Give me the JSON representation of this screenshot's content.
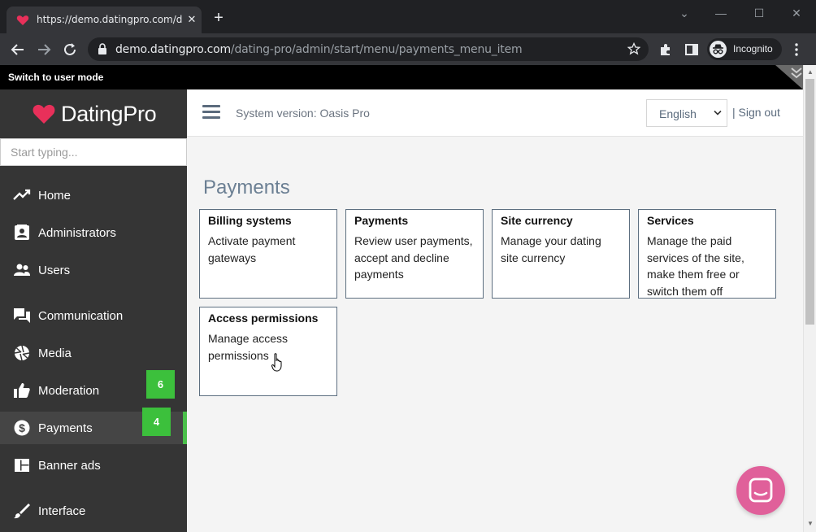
{
  "browser": {
    "tab_title": "https://demo.datingpro.com/dating-pro/admin/start/menu/payments_menu_item",
    "url_host": "demo.datingpro.com",
    "url_path": "/dating-pro/admin/start/menu/payments_menu_item",
    "incognito_label": "Incognito"
  },
  "userbar": {
    "switch_label": "Switch to user mode"
  },
  "sidebar": {
    "logo_text": "DatingPro",
    "search_placeholder": "Start typing...",
    "items": [
      {
        "label": "Home",
        "icon": "trending-up-icon"
      },
      {
        "label": "Administrators",
        "icon": "contact-card-icon"
      },
      {
        "label": "Users",
        "icon": "people-icon"
      },
      {
        "label": "Communication",
        "icon": "chat-icon"
      },
      {
        "label": "Media",
        "icon": "aperture-icon"
      },
      {
        "label": "Moderation",
        "icon": "thumbs-up-icon",
        "badge": "6"
      },
      {
        "label": "Payments",
        "icon": "dollar-icon",
        "badge": "4",
        "active": true
      },
      {
        "label": "Banner ads",
        "icon": "banner-icon"
      },
      {
        "label": "Interface",
        "icon": "brush-icon"
      }
    ]
  },
  "header": {
    "system_version": "System version: Oasis Pro",
    "language": "English",
    "sign_out": "| Sign out"
  },
  "page": {
    "title": "Payments",
    "cards": [
      {
        "title": "Billing systems",
        "desc": "Activate payment gateways"
      },
      {
        "title": "Payments",
        "desc": "Review user payments, accept and decline payments"
      },
      {
        "title": "Site currency",
        "desc": "Manage your dating site currency"
      },
      {
        "title": "Services",
        "desc": "Manage the paid services of the site, make them free or switch them off"
      },
      {
        "title": "Access permissions",
        "desc": "Manage access permissions"
      }
    ]
  },
  "colors": {
    "sidebar_bg": "#353535",
    "badge_green": "#3cc03c",
    "accent_pink": "#e0609a",
    "brand_heart": "#e8305a"
  }
}
